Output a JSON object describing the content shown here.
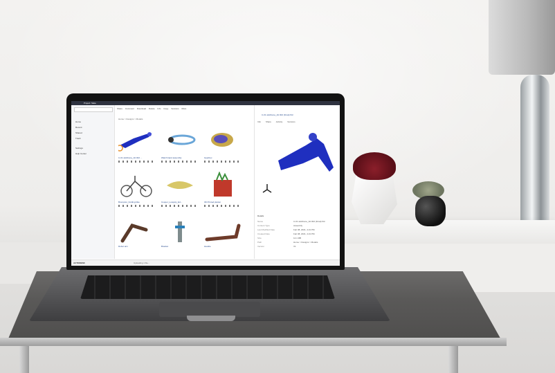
{
  "scene": {
    "description_free": true,
    "objects": [
      "laptop",
      "desk",
      "white-vase-with-red-flower",
      "black-vase-with-plant",
      "chrome-table-lamp",
      "white-shelf"
    ]
  },
  "screen": {
    "app_title": "Project: Slate",
    "search_placeholder": "Search...",
    "sidebar": {
      "items": [
        "Home",
        "Recent",
        "Shared",
        "Trash",
        "Settings",
        "Help Center"
      ]
    },
    "toolbar": {
      "items": [
        "Share",
        "Comment",
        "Download",
        "Delete",
        "Info",
        "Copy",
        "Versions",
        "More"
      ]
    },
    "breadcrumb": "Home > Designs > Models",
    "cards": [
      {
        "label": "C-01 wishbone_Alt 002 ..."
      },
      {
        "label": "Watch band assembly"
      },
      {
        "label": "Gearbox"
      },
      {
        "label": "Brompton_Folding bike"
      },
      {
        "label": "Cooper_Lowpoly_Ed..."
      },
      {
        "label": "3D Printed planter"
      },
      {
        "label": "Robot arm"
      },
      {
        "label": "Bracket"
      },
      {
        "label": "Handle"
      }
    ],
    "detail": {
      "title": "C-01 wishbone_Alt 002 (Final).f3d",
      "tabs": [
        "Info",
        "Share",
        "Activity",
        "Versions"
      ],
      "section_heading": "Details",
      "properties": [
        {
          "key": "Name",
          "value": "C-01 wishbone_Alt 002 (Final).f3d"
        },
        {
          "key": "Content Type",
          "value": "Assembly"
        },
        {
          "key": "Last Modified Date",
          "value": "Feb 08, 2021, 4:21 PM"
        },
        {
          "key": "Created Date",
          "value": "Feb 08, 2021, 4:21 PM"
        },
        {
          "key": "Size",
          "value": "14.1 MB"
        },
        {
          "key": "Path",
          "value": "Home > Designs > Models"
        },
        {
          "key": "Version",
          "value": "V1"
        }
      ]
    },
    "status": {
      "brand": "AUTODESK",
      "text": "Uploading 1 file..."
    }
  },
  "colors": {
    "accent": "#2a4d8f",
    "model_blue": "#1f2fbf",
    "orange_badge": "#e7902a",
    "screen_bezel": "#121212"
  }
}
